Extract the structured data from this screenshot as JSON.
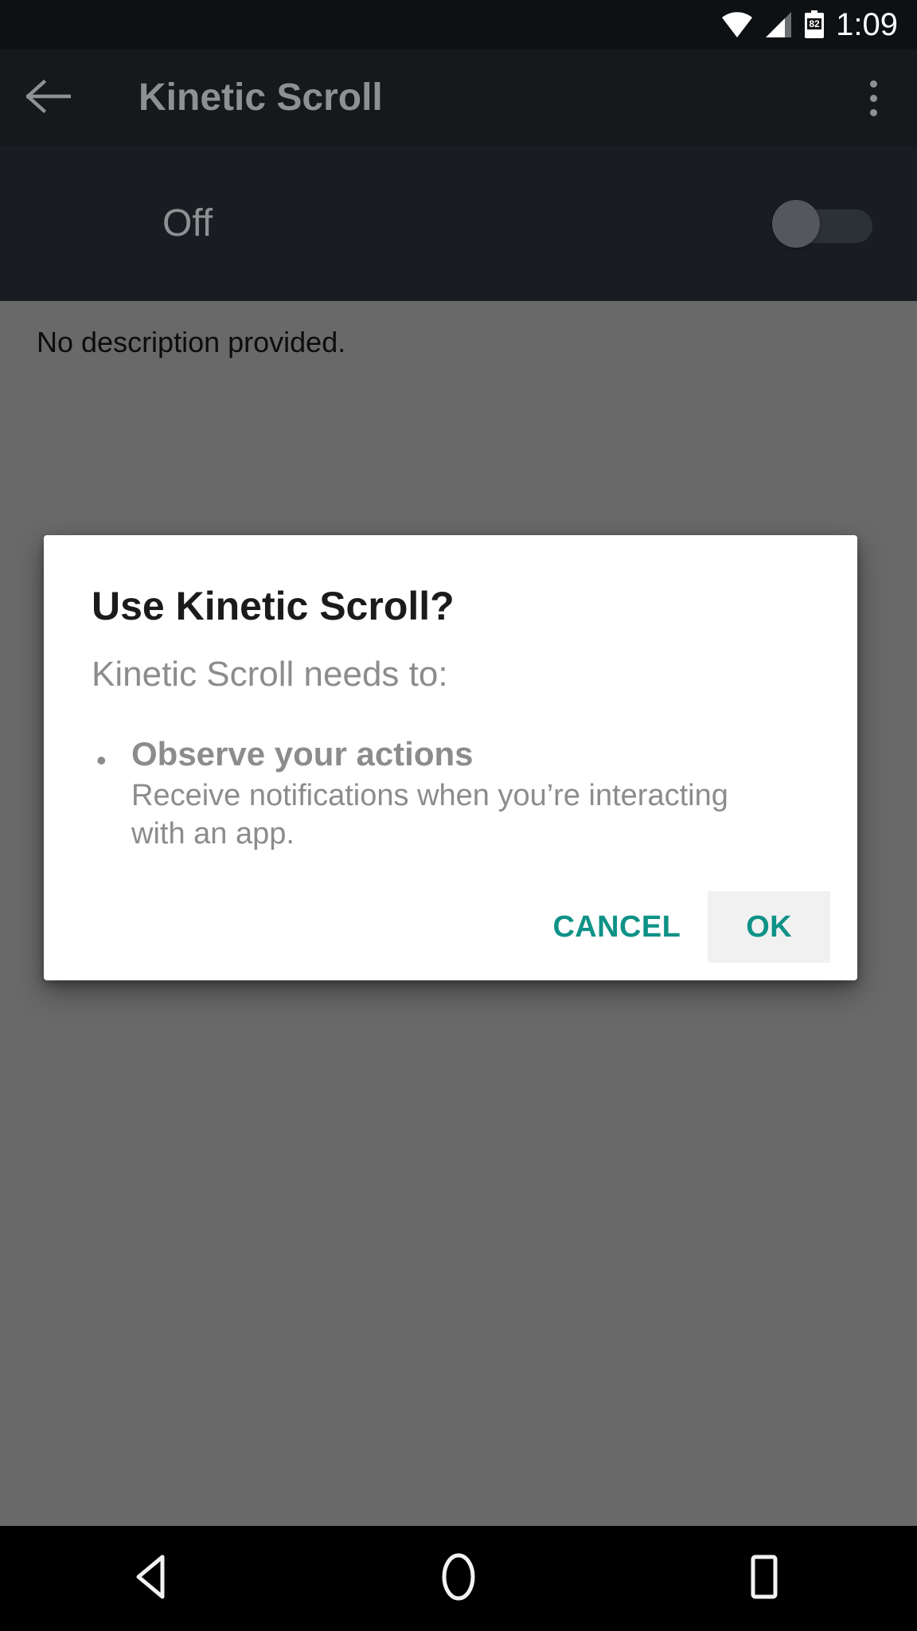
{
  "status_bar": {
    "wifi_icon": "wifi-icon",
    "signal_icon": "cell-signal-icon",
    "battery_icon": "battery-icon",
    "battery_level": "82",
    "clock": "1:09"
  },
  "action_bar": {
    "back_icon": "back-arrow-icon",
    "title": "Kinetic Scroll",
    "overflow_icon": "overflow-menu-icon"
  },
  "switch_row": {
    "label": "Off",
    "state": "off"
  },
  "content": {
    "description": "No description provided."
  },
  "dialog": {
    "title": "Use Kinetic Scroll?",
    "subtitle": "Kinetic Scroll needs to:",
    "bullet_glyph": "•",
    "permissions": [
      {
        "title": "Observe your actions",
        "text": "Receive notifications when you’re interacting with an app."
      }
    ],
    "cancel_label": "CANCEL",
    "ok_label": "OK",
    "accent_color": "#0f9287",
    "pressed_bg": "#f1f1f1"
  },
  "nav_bar": {
    "back_icon": "nav-back-icon",
    "home_icon": "nav-home-icon",
    "recents_icon": "nav-recents-icon"
  }
}
